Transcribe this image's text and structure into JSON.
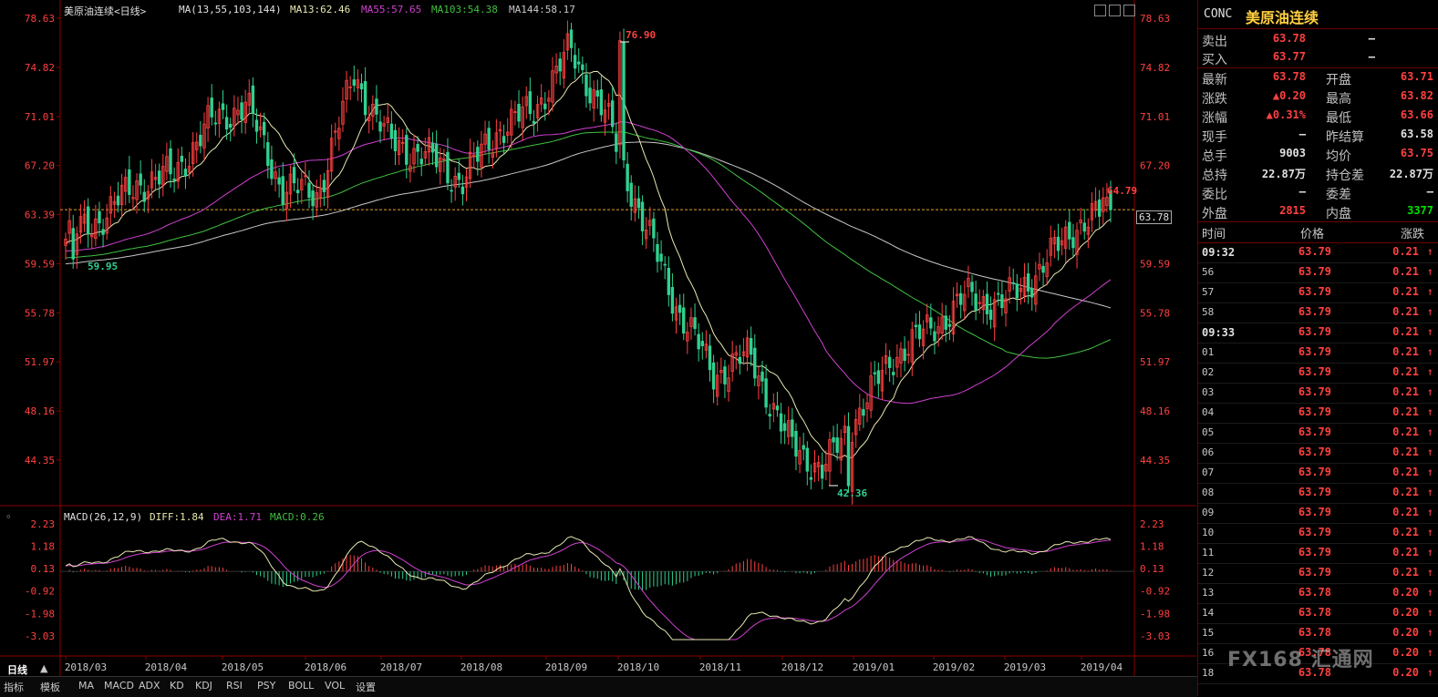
{
  "main_header": {
    "title": "美原油连续<日线>",
    "ma_def": "MA(13,55,103,144)",
    "ma13": "MA13:62.46",
    "ma55": "MA55:57.65",
    "ma103": "MA103:54.38",
    "ma144": "MA144:58.17"
  },
  "macd_header": {
    "def": "MACD(26,12,9)",
    "diff": "DIFF:1.84",
    "dea": "DEA:1.71",
    "macd": "MACD:0.26"
  },
  "price_axis": [
    "78.63",
    "74.82",
    "71.01",
    "67.20",
    "63.39",
    "59.59",
    "55.78",
    "51.97",
    "48.16",
    "44.35"
  ],
  "macd_axis": [
    "2.23",
    "1.18",
    "0.13",
    "-0.92",
    "-1.98",
    "-3.03"
  ],
  "date_axis": [
    "2018/03",
    "2018/04",
    "2018/05",
    "2018/06",
    "2018/07",
    "2018/08",
    "2018/09",
    "2018/10",
    "2018/11",
    "2018/12",
    "2019/01",
    "2019/02",
    "2019/03",
    "2019/04"
  ],
  "annotations": {
    "high": "76.90",
    "low": "42.36",
    "early_low": "59.95",
    "recent_high": "64.79",
    "last_price_tag": "63.78"
  },
  "colors": {
    "up": "#ff4040",
    "down": "#30d090",
    "ma13": "#e8e8b0",
    "ma55": "#d040d0",
    "ma103": "#40c040",
    "ma144": "#c8c8c8",
    "macd_dea": "#d040d0",
    "macd_diff": "#e8e8b0"
  },
  "chart_data": {
    "type": "candlestick",
    "title": "美原油连续<日线>",
    "ylim": [
      42.36,
      78.63
    ],
    "x_range": [
      "2018/03",
      "2019/04"
    ],
    "key_points": [
      {
        "date": "2018/03",
        "price": 59.95,
        "label": "59.95"
      },
      {
        "date": "2018/10",
        "price": 76.9,
        "label": "76.90"
      },
      {
        "date": "2018/12",
        "price": 42.36,
        "label": "42.36"
      },
      {
        "date": "2019/04",
        "price": 64.79,
        "label": "64.79"
      }
    ],
    "close_path": [
      [
        "2018/03",
        61.5
      ],
      [
        "2018/03",
        63.2
      ],
      [
        "2018/04",
        65.8
      ],
      [
        "2018/04",
        66.5
      ],
      [
        "2018/05",
        70.5
      ],
      [
        "2018/05",
        72.0
      ],
      [
        "2018/06",
        65.5
      ],
      [
        "2018/06",
        65.0
      ],
      [
        "2018/07",
        74.2
      ],
      [
        "2018/07",
        69.0
      ],
      [
        "2018/08",
        68.0
      ],
      [
        "2018/08",
        66.0
      ],
      [
        "2018/09",
        70.0
      ],
      [
        "2018/09",
        71.5
      ],
      [
        "2018/10",
        76.2
      ],
      [
        "2018/10",
        71.0
      ],
      [
        "2018/11",
        63.0
      ],
      [
        "2018/11",
        56.0
      ],
      [
        "2018/11",
        51.0
      ],
      [
        "2018/12",
        52.5
      ],
      [
        "2018/12",
        46.0
      ],
      [
        "2018/12",
        43.5
      ],
      [
        "2019/01",
        48.0
      ],
      [
        "2019/01",
        52.5
      ],
      [
        "2019/02",
        54.5
      ],
      [
        "2019/02",
        57.0
      ],
      [
        "2019/03",
        56.5
      ],
      [
        "2019/03",
        59.0
      ],
      [
        "2019/04",
        62.5
      ],
      [
        "2019/04",
        63.78
      ]
    ],
    "ma_last": {
      "MA13": 62.46,
      "MA55": 57.65,
      "MA103": 54.38,
      "MA144": 58.17
    },
    "macd_last": {
      "DIFF": 1.84,
      "DEA": 1.71,
      "MACD": 0.26
    }
  },
  "panel": {
    "code": "CONC",
    "name": "美原油连续",
    "sell_label": "卖出",
    "sell_price": "63.78",
    "sell_vol": "—",
    "buy_label": "买入",
    "buy_price": "63.77",
    "buy_vol": "—",
    "rows": [
      {
        "l1": "最新",
        "v1": "63.78",
        "c1": "red",
        "l2": "开盘",
        "v2": "63.71",
        "c2": "red"
      },
      {
        "l1": "涨跌",
        "v1": "▲0.20",
        "c1": "red",
        "l2": "最高",
        "v2": "63.82",
        "c2": "red"
      },
      {
        "l1": "涨幅",
        "v1": "▲0.31%",
        "c1": "red",
        "l2": "最低",
        "v2": "63.66",
        "c2": "red"
      },
      {
        "l1": "现手",
        "v1": "—",
        "c1": "wht",
        "l2": "昨结算",
        "v2": "63.58",
        "c2": "wht"
      },
      {
        "l1": "总手",
        "v1": "9003",
        "c1": "wht",
        "l2": "均价",
        "v2": "63.75",
        "c2": "red"
      },
      {
        "l1": "总持",
        "v1": "22.87万",
        "c1": "wht",
        "l2": "持仓差",
        "v2": "22.87万",
        "c2": "wht"
      },
      {
        "l1": "委比",
        "v1": "—",
        "c1": "wht",
        "l2": "委差",
        "v2": "—",
        "c2": "wht"
      },
      {
        "l1": "外盘",
        "v1": "2815",
        "c1": "red",
        "l2": "内盘",
        "v2": "3377",
        "c2": "grn"
      }
    ],
    "tick_header": {
      "time": "时间",
      "price": "价格",
      "change": "涨跌"
    },
    "ticks": [
      {
        "t": "09:32",
        "big": true,
        "p": "63.79",
        "c": "0.21"
      },
      {
        "t": "56",
        "big": false,
        "p": "63.79",
        "c": "0.21"
      },
      {
        "t": "57",
        "big": false,
        "p": "63.79",
        "c": "0.21"
      },
      {
        "t": "58",
        "big": false,
        "p": "63.79",
        "c": "0.21"
      },
      {
        "t": "09:33",
        "big": true,
        "p": "63.79",
        "c": "0.21"
      },
      {
        "t": "01",
        "big": false,
        "p": "63.79",
        "c": "0.21"
      },
      {
        "t": "02",
        "big": false,
        "p": "63.79",
        "c": "0.21"
      },
      {
        "t": "03",
        "big": false,
        "p": "63.79",
        "c": "0.21"
      },
      {
        "t": "04",
        "big": false,
        "p": "63.79",
        "c": "0.21"
      },
      {
        "t": "05",
        "big": false,
        "p": "63.79",
        "c": "0.21"
      },
      {
        "t": "06",
        "big": false,
        "p": "63.79",
        "c": "0.21"
      },
      {
        "t": "07",
        "big": false,
        "p": "63.79",
        "c": "0.21"
      },
      {
        "t": "08",
        "big": false,
        "p": "63.79",
        "c": "0.21"
      },
      {
        "t": "09",
        "big": false,
        "p": "63.79",
        "c": "0.21"
      },
      {
        "t": "10",
        "big": false,
        "p": "63.79",
        "c": "0.21"
      },
      {
        "t": "11",
        "big": false,
        "p": "63.79",
        "c": "0.21"
      },
      {
        "t": "12",
        "big": false,
        "p": "63.79",
        "c": "0.21"
      },
      {
        "t": "13",
        "big": false,
        "p": "63.78",
        "c": "0.20"
      },
      {
        "t": "14",
        "big": false,
        "p": "63.78",
        "c": "0.20"
      },
      {
        "t": "15",
        "big": false,
        "p": "63.78",
        "c": "0.20"
      },
      {
        "t": "16",
        "big": false,
        "p": "63.78",
        "c": "0.20"
      },
      {
        "t": "18",
        "big": false,
        "p": "63.78",
        "c": "0.20"
      }
    ]
  },
  "bottom_tabs": [
    "日线",
    "指标",
    "模板",
    "MA",
    "MACD",
    "ADX",
    "KD",
    "KDJ",
    "RSI",
    "PSY",
    "BOLL",
    "VOL",
    "设置"
  ],
  "watermark": "FX168 汇通网"
}
